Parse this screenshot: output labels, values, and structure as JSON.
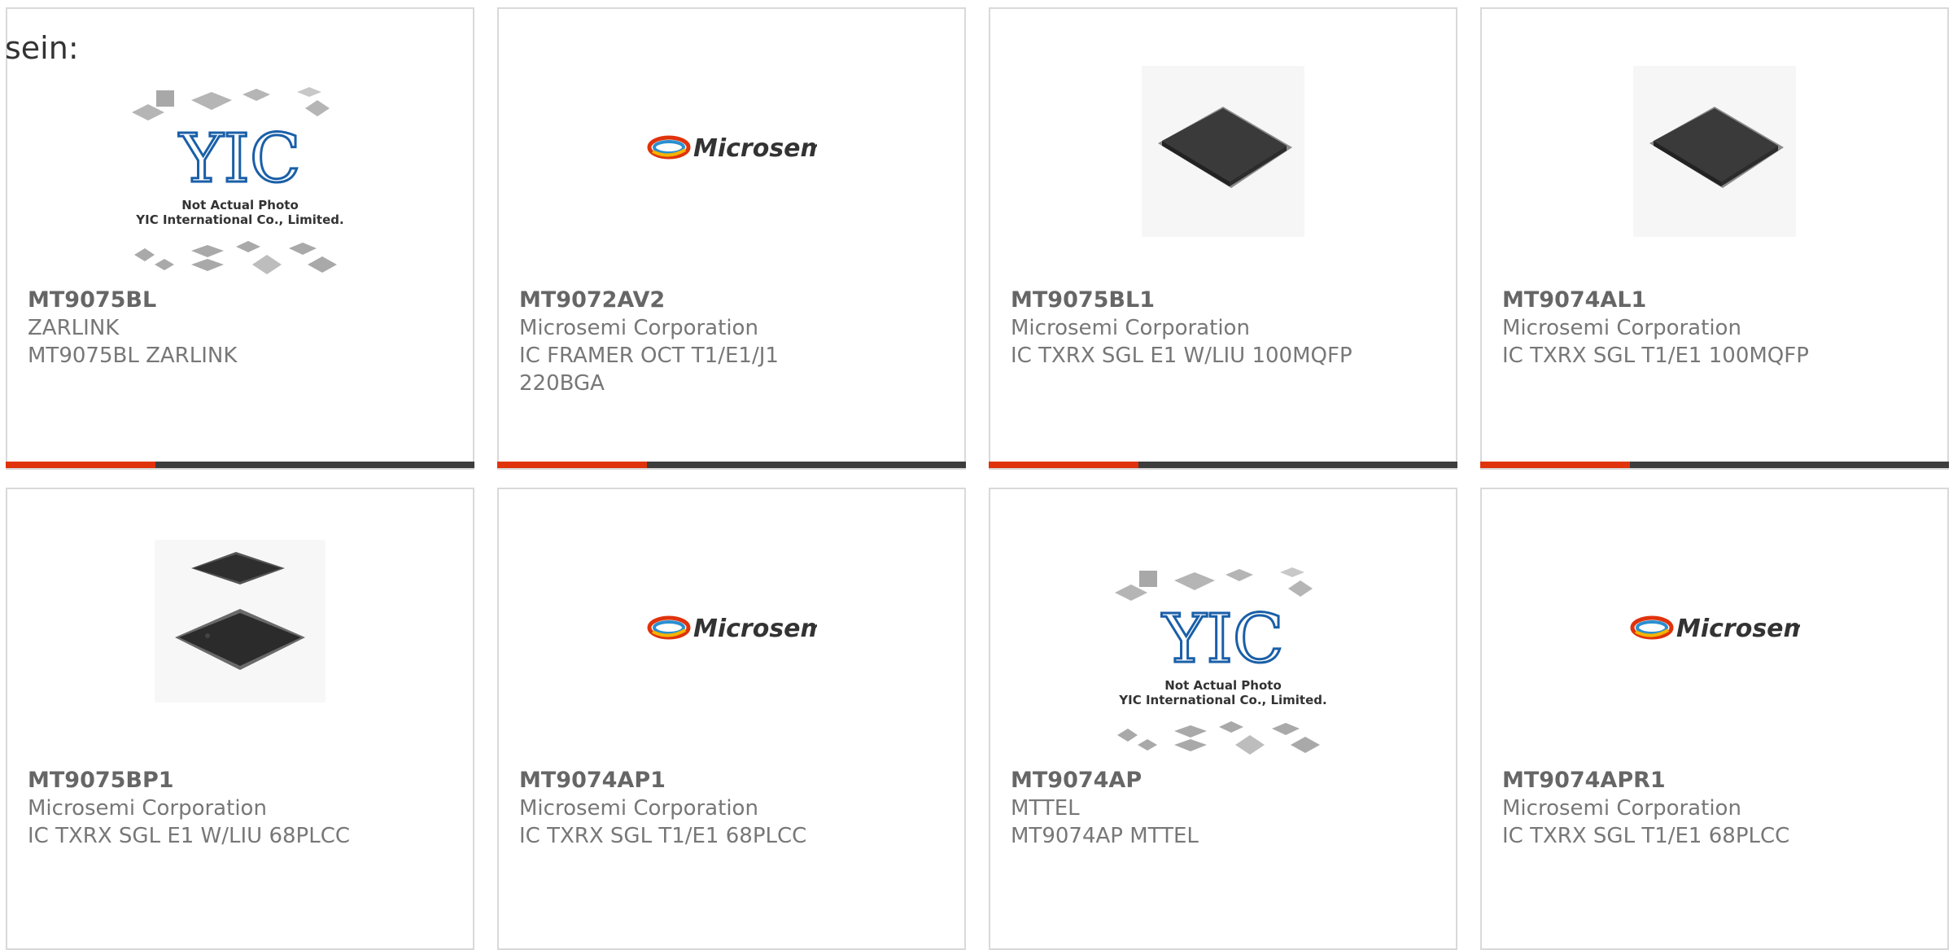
{
  "intro_text": "sein:",
  "products": [
    {
      "part": "MT9075BL",
      "manufacturer": "ZARLINK",
      "description": "MT9075BL ZARLINK",
      "image": "yic-placeholder",
      "image_caption": [
        "Not Actual Photo",
        "YIC International Co., Limited."
      ]
    },
    {
      "part": "MT9072AV2",
      "manufacturer": "Microsemi Corporation",
      "description_lines": [
        "IC FRAMER OCT T1/E1/J1",
        "220BGA"
      ],
      "image": "microsemi-logo"
    },
    {
      "part": "MT9075BL1",
      "manufacturer": "Microsemi Corporation",
      "description": "IC TXRX SGL E1 W/LIU 100MQFP",
      "image": "qfp-chip"
    },
    {
      "part": "MT9074AL1",
      "manufacturer": "Microsemi Corporation",
      "description": "IC TXRX SGL T1/E1 100MQFP",
      "image": "qfp-chip"
    },
    {
      "part": "MT9075BP1",
      "manufacturer": "Microsemi Corporation",
      "description": "IC TXRX SGL E1 W/LIU 68PLCC",
      "image": "plcc-chip"
    },
    {
      "part": "MT9074AP1",
      "manufacturer": "Microsemi Corporation",
      "description": "IC TXRX SGL T1/E1 68PLCC",
      "image": "microsemi-logo"
    },
    {
      "part": "MT9074AP",
      "manufacturer": "MTTEL",
      "description": "MT9074AP MTTEL",
      "image": "yic-placeholder",
      "image_caption": [
        "Not Actual Photo",
        "YIC International Co., Limited."
      ]
    },
    {
      "part": "MT9074APR1",
      "manufacturer": "Microsemi Corporation",
      "description": "IC TXRX SGL T1/E1 68PLCC",
      "image": "microsemi-logo"
    }
  ],
  "brand_logo_text": "Microsemi",
  "yic_logo_text": "YIC",
  "colors": {
    "accent": "#e0330c",
    "bar": "#3d3d3d",
    "border": "#d9d9d9",
    "text": "#777777"
  }
}
